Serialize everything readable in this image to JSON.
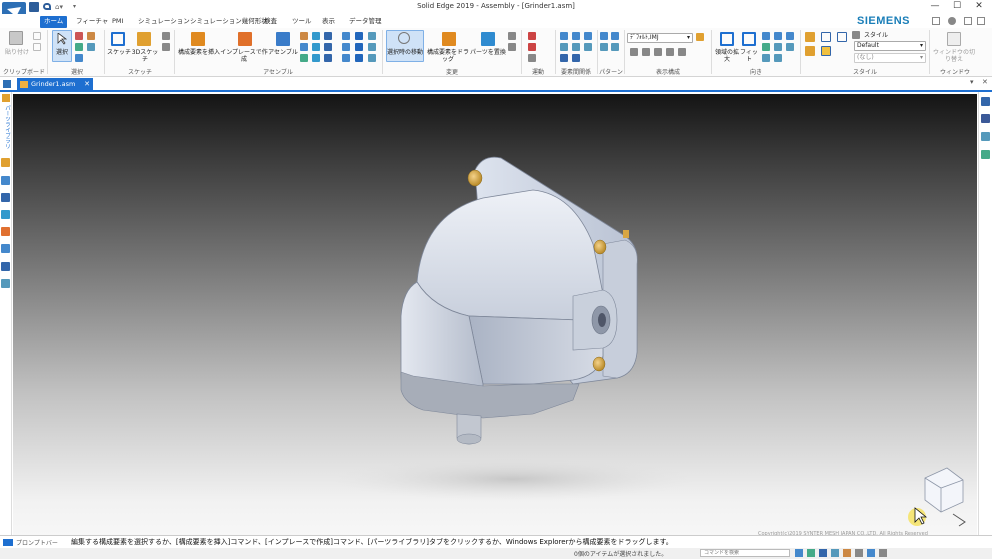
{
  "window": {
    "title": "Solid Edge 2019 - Assembly - [Grinder1.asm]"
  },
  "tabs": [
    "ホーム",
    "フィーチャ",
    "PMI",
    "シミュレーション",
    "シミュレーション幾何形状",
    "検査",
    "ツール",
    "表示",
    "データ管理"
  ],
  "brand": "SIEMENS",
  "ribbon": {
    "clipboard": {
      "paste": "貼り付け",
      "group": "クリップボード"
    },
    "select": {
      "select": "選択",
      "group": "選択"
    },
    "sketch": {
      "sketch": "スケッチ",
      "sketch3d": "3Dスケッチ",
      "group": "スケッチ"
    },
    "assemble": {
      "insert": "構成要素を挿入",
      "inplace": "インプレースで作成",
      "assemble": "アセンブル",
      "group": "アセンブル"
    },
    "modify": {
      "move": "選択時の移動",
      "drag": "構成要素をドラッグ",
      "replace": "パーツを置換",
      "group": "変更"
    },
    "motion": {
      "group": "運動"
    },
    "relations": {
      "group": "要素間関係"
    },
    "pattern": {
      "group": "パターン"
    },
    "display": {
      "dropdown": "ﾃﾞﾌｫﾙﾄ,IMJ",
      "group": "表示構成"
    },
    "orient": {
      "zoom_area": "領域の拡大",
      "fit": "フィット",
      "group": "向き"
    },
    "style": {
      "style_label": "スタイル",
      "style_value": "Default",
      "style_none": "(なし)",
      "group": "スタイル"
    },
    "window": {
      "switch": "ウィンドウの切り替え",
      "group": "ウィンドウ"
    }
  },
  "document": {
    "tab_label": "Grinder1.asm",
    "side_label": "パーツライブラリ"
  },
  "viewport": {
    "copyright": "Copyright(c)2019 SYNTER MESH JAPAN CO.,LTD. All Rights Reserved"
  },
  "prompt": {
    "label": "プロンプトバー",
    "text": "編集する構成要素を選択するか、[構成要素を挿入]コマンド、[インプレースで作成]コマンド、[パーツライブラリ]タブをクリックするか、Windows Explorerから構成要素をドラッグします。"
  },
  "status": {
    "text": "0個のアイテムが選択されました。",
    "search_placeholder": "コマンドを検索"
  },
  "colors": {
    "accent": "#1e6fd0",
    "brand": "#1a7eb8"
  }
}
